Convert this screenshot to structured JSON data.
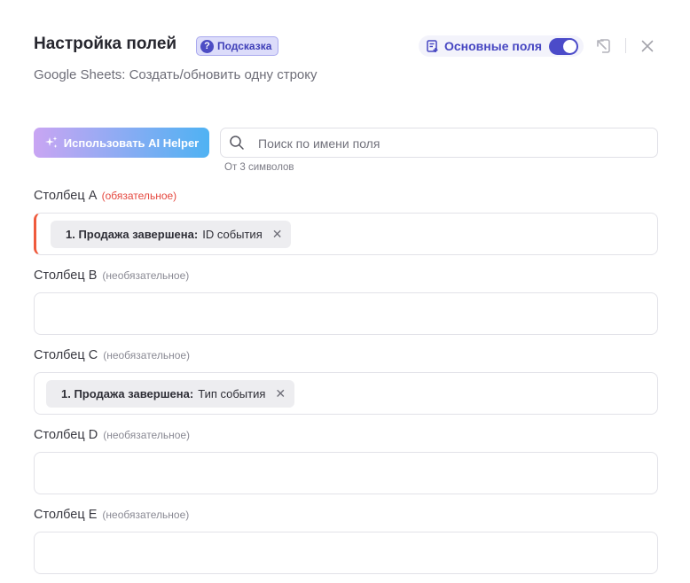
{
  "header": {
    "title": "Настройка полей",
    "hint_label": "Подсказка",
    "subtitle": "Google Sheets: Создать/обновить одну строку",
    "main_fields_label": "Основные поля",
    "main_fields_toggle_on": true
  },
  "toolbar": {
    "ai_helper_label": "Использовать AI Helper",
    "search_placeholder": "Поиск по имени поля",
    "search_hint": "От 3 символов"
  },
  "fields": [
    {
      "name": "Столбец A",
      "qualifier": "(обязательное)",
      "required": true,
      "chip": {
        "source": "1. Продажа завершена:",
        "value": "ID события"
      }
    },
    {
      "name": "Столбец B",
      "qualifier": "(необязательное)",
      "required": false,
      "chip": null
    },
    {
      "name": "Столбец C",
      "qualifier": "(необязательное)",
      "required": false,
      "chip": {
        "source": "1. Продажа завершена:",
        "value": "Тип события"
      }
    },
    {
      "name": "Столбец D",
      "qualifier": "(необязательное)",
      "required": false,
      "chip": null
    },
    {
      "name": "Столбец E",
      "qualifier": "(необязательное)",
      "required": false,
      "chip": null
    }
  ],
  "colors": {
    "accent": "#4b4bc9",
    "required": "#e5483f",
    "ai_gradient_start": "#c9a5f3",
    "ai_gradient_end": "#4fb2f3"
  },
  "icons": [
    "question-icon",
    "list-icon",
    "collapse-icon",
    "close-icon",
    "sparkle-icon",
    "search-icon",
    "remove-icon"
  ]
}
